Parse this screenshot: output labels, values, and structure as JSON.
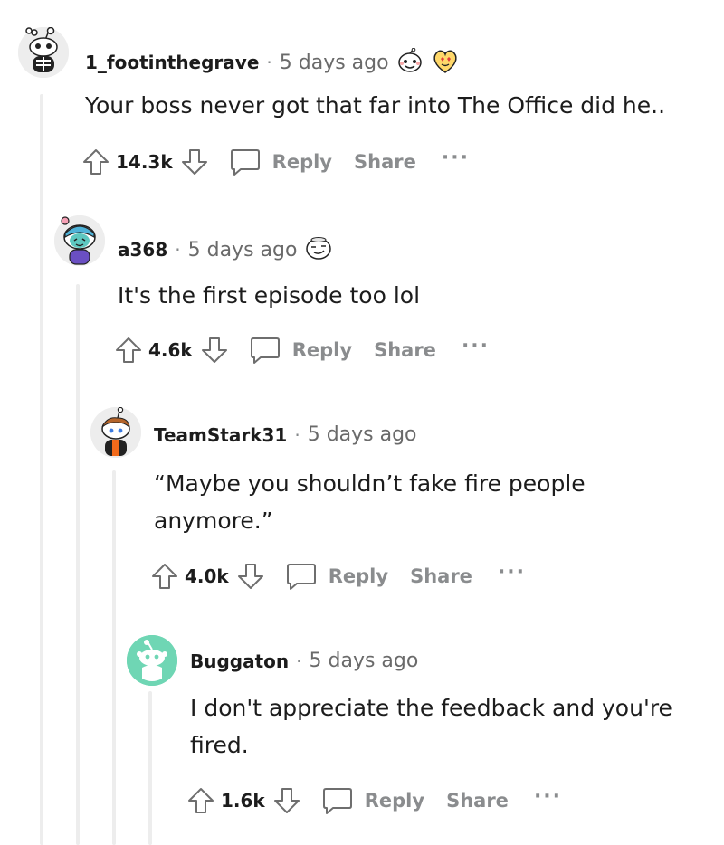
{
  "comments": [
    {
      "username": "1_footinthegrave",
      "separator": "·",
      "time": "5 days ago",
      "body_lines": [
        "Your boss never got that far into The Office did he.."
      ],
      "score": "14.3k",
      "reply_label": "Reply",
      "share_label": "Share",
      "more_label": "···",
      "avatar_icon": "skeleton-snoo-avatar",
      "award_icons": [
        "wholesome-award-icon",
        "heart-eyes-award-icon"
      ]
    },
    {
      "username": "a368",
      "separator": "·",
      "time": "5 days ago",
      "body_lines": [
        "It's the first episode too lol"
      ],
      "score": "4.6k",
      "reply_label": "Reply",
      "share_label": "Share",
      "more_label": "···",
      "avatar_icon": "beanie-snoo-avatar",
      "award_icons": [
        "smirk-award-icon"
      ]
    },
    {
      "username": "TeamStark31",
      "separator": "·",
      "time": "5 days ago",
      "body_lines": [
        "“Maybe you shouldn’t fake fire people",
        "anymore.”"
      ],
      "score": "4.0k",
      "reply_label": "Reply",
      "share_label": "Share",
      "more_label": "···",
      "avatar_icon": "hoodie-snoo-avatar"
    },
    {
      "username": "Buggaton",
      "separator": "·",
      "time": "5 days ago",
      "body_lines": [
        "I don't appreciate the feedback and you're",
        "fired."
      ],
      "score": "1.6k",
      "reply_label": "Reply",
      "share_label": "Share",
      "more_label": "···",
      "avatar_icon": "default-snoo-avatar"
    }
  ],
  "colors": {
    "avatar_teal": "#6fd6b4",
    "thread_line": "#ededed",
    "muted_text": "#8a8c8e"
  }
}
